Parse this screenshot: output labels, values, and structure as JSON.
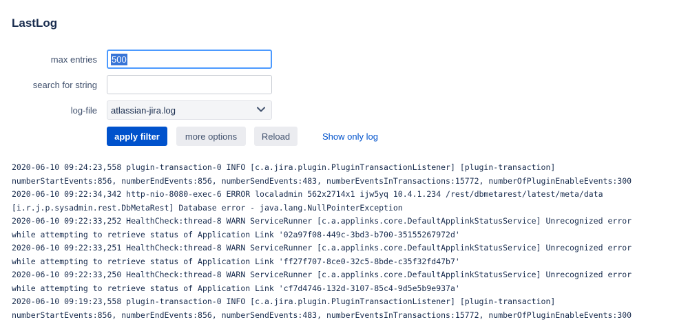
{
  "page": {
    "title": "LastLog"
  },
  "form": {
    "max_entries": {
      "label": "max entries",
      "value": "500"
    },
    "search": {
      "label": "search for string",
      "value": ""
    },
    "logfile": {
      "label": "log-file",
      "selected": "atlassian-jira.log"
    }
  },
  "buttons": {
    "apply": "apply filter",
    "more_options": "more options",
    "reload": "Reload",
    "show_only_log": "Show only log"
  },
  "colors": {
    "primary": "#0052cc",
    "focus": "#4c9aff",
    "button_gray": "#ebecf0"
  },
  "log_lines": [
    "2020-06-10 09:24:23,558 plugin-transaction-0 INFO [c.a.jira.plugin.PluginTransactionListener] [plugin-transaction]",
    "numberStartEvents:856, numberEndEvents:856, numberSendEvents:483, numberEventsInTransactions:15772, numberOfPluginEnableEvents:300",
    "2020-06-10 09:22:34,342 http-nio-8080-exec-6 ERROR localadmin 562x2714x1 ijw5yq 10.4.1.234 /rest/dbmetarest/latest/meta/data",
    "[i.r.j.p.sysadmin.rest.DbMetaRest] Database error - java.lang.NullPointerException",
    "2020-06-10 09:22:33,252 HealthCheck:thread-8 WARN ServiceRunner [c.a.applinks.core.DefaultApplinkStatusService] Unrecognized error",
    "while attempting to retrieve status of Application Link '02a97f08-449c-3bd3-b700-35155267972d'",
    "2020-06-10 09:22:33,251 HealthCheck:thread-8 WARN ServiceRunner [c.a.applinks.core.DefaultApplinkStatusService] Unrecognized error",
    "while attempting to retrieve status of Application Link 'ff27f707-8ce0-32c5-8bde-c35f32fd47b7'",
    "2020-06-10 09:22:33,250 HealthCheck:thread-8 WARN ServiceRunner [c.a.applinks.core.DefaultApplinkStatusService] Unrecognized error",
    "while attempting to retrieve status of Application Link 'cf7d4746-132d-3107-85c4-9d5e5b9e937a'",
    "2020-06-10 09:19:23,558 plugin-transaction-0 INFO [c.a.jira.plugin.PluginTransactionListener] [plugin-transaction]",
    "numberStartEvents:856, numberEndEvents:856, numberSendEvents:483, numberEventsInTransactions:15772, numberOfPluginEnableEvents:300"
  ]
}
